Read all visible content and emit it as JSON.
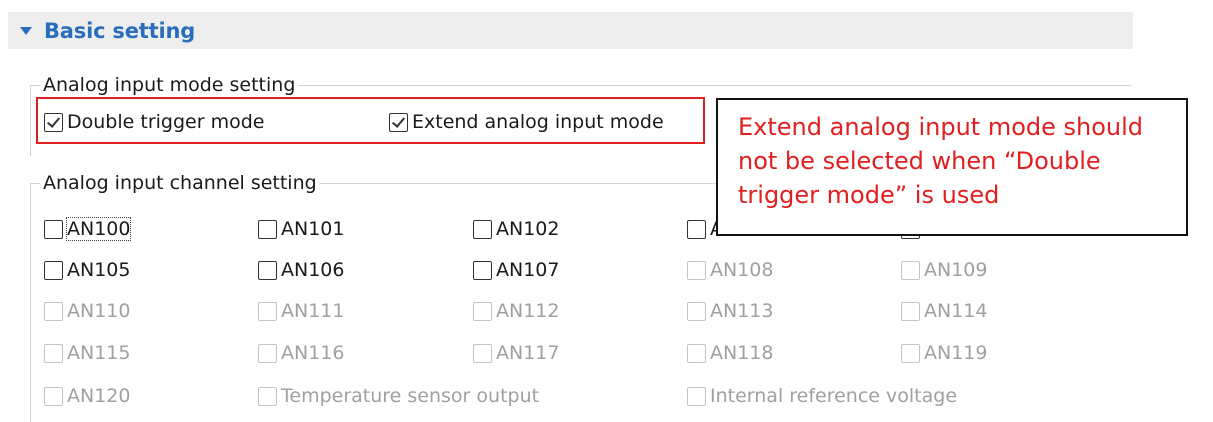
{
  "section": {
    "title": "Basic setting"
  },
  "mode_group": {
    "title": "Analog input mode setting",
    "double_trigger_label": "Double trigger mode",
    "double_trigger_checked": true,
    "extend_label": "Extend analog input mode",
    "extend_checked": true
  },
  "channel_group": {
    "title": "Analog input channel setting",
    "rows": [
      [
        "AN100",
        "AN101",
        "AN102",
        "AN103",
        "AN104"
      ],
      [
        "AN105",
        "AN106",
        "AN107",
        "AN108",
        "AN109"
      ],
      [
        "AN110",
        "AN111",
        "AN112",
        "AN113",
        "AN114"
      ],
      [
        "AN115",
        "AN116",
        "AN117",
        "AN118",
        "AN119"
      ]
    ],
    "last_row": {
      "an120": "AN120",
      "temp_sensor": "Temperature sensor output",
      "internal_ref": "Internal reference voltage"
    }
  },
  "callout": {
    "text": "Extend analog input mode should not be selected when “Double trigger mode” is used"
  },
  "colors": {
    "header_text": "#2a6ebb",
    "highlight_red": "#e02020",
    "disabled_text": "#a0a0a0"
  }
}
